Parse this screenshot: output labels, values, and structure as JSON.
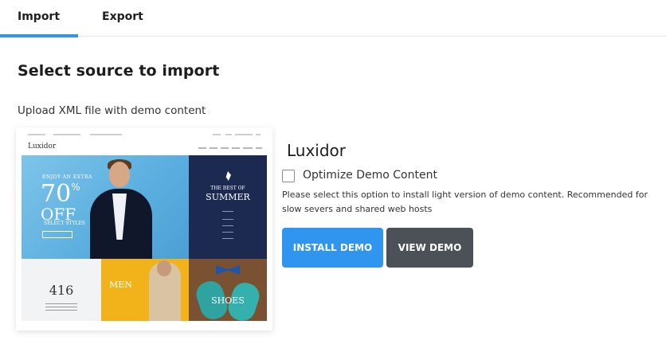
{
  "tabs": [
    {
      "label": "Import",
      "active": true
    },
    {
      "label": "Export",
      "active": false
    }
  ],
  "colors": {
    "accent": "#2f95ee",
    "secondary_button": "#4b5157"
  },
  "main": {
    "heading": "Select source to import",
    "subheading": "Upload XML file with demo content"
  },
  "preview": {
    "logo_text": "Luxidor",
    "hero_line1": "ENJOY AN EXTRA",
    "hero_percent": "70",
    "hero_percent_sign": "%",
    "hero_off": "OFF",
    "hero_line2": "SELECT STYLES",
    "summer_line1": "THE BEST OF",
    "summer_line2": "SUMMER",
    "promo_number": "416",
    "men_label": "MEN",
    "shoes_label": "SHOES"
  },
  "demo": {
    "title": "Luxidor",
    "optimize_label": "Optimize Demo Content",
    "optimize_checked": false,
    "help_text": "Please select this option to install light version of demo content. Recommended for slow severs and shared web hosts",
    "install_label": "INSTALL DEMO",
    "view_label": "VIEW DEMO"
  }
}
